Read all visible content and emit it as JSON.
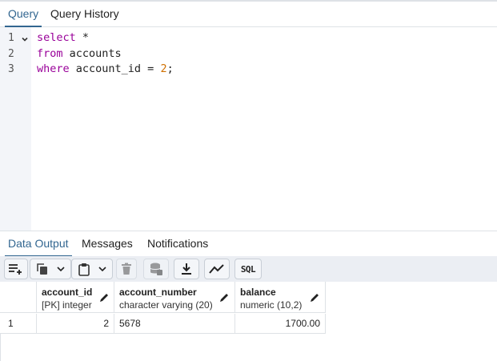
{
  "editor_tabs": [
    {
      "label": "Query",
      "active": true
    },
    {
      "label": "Query History",
      "active": false
    }
  ],
  "editor": {
    "lines": [
      {
        "number": "1",
        "tokens": [
          {
            "t": "select",
            "k": "kw"
          },
          {
            "t": " *",
            "k": "plain"
          }
        ]
      },
      {
        "number": "2",
        "tokens": [
          {
            "t": "from",
            "k": "kw"
          },
          {
            "t": " accounts",
            "k": "plain"
          }
        ]
      },
      {
        "number": "3",
        "tokens": [
          {
            "t": "where",
            "k": "kw"
          },
          {
            "t": " account_id = ",
            "k": "plain"
          },
          {
            "t": "2",
            "k": "num"
          },
          {
            "t": ";",
            "k": "plain"
          }
        ]
      }
    ]
  },
  "output_tabs": [
    {
      "label": "Data Output",
      "active": true
    },
    {
      "label": "Messages",
      "active": false
    },
    {
      "label": "Notifications",
      "active": false
    }
  ],
  "toolbar": {
    "buttons": [
      {
        "name": "add-row-button",
        "icon": "add-row-icon"
      },
      {
        "name": "copy-button",
        "icon": "copy-icon"
      },
      {
        "name": "copy-options-dropdown",
        "icon": "chevron-down-icon"
      },
      {
        "name": "paste-button",
        "icon": "paste-icon"
      },
      {
        "name": "paste-options-dropdown",
        "icon": "chevron-down-icon"
      },
      {
        "name": "delete-button",
        "icon": "trash-icon",
        "disabled": true
      },
      {
        "name": "save-data-button",
        "icon": "database-save-icon",
        "disabled": true
      },
      {
        "name": "download-button",
        "icon": "download-icon"
      },
      {
        "name": "graph-visualiser-button",
        "icon": "line-chart-icon"
      },
      {
        "name": "sql-button",
        "icon": "sql-icon",
        "label": "SQL"
      }
    ]
  },
  "result_grid": {
    "columns": [
      {
        "name": "account_id",
        "type": "[PK] integer"
      },
      {
        "name": "account_number",
        "type": "character varying (20)"
      },
      {
        "name": "balance",
        "type": "numeric (10,2)"
      }
    ],
    "rows": [
      {
        "row_number": "1",
        "values": [
          "2",
          "5678",
          "1700.00"
        ]
      }
    ]
  },
  "colors": {
    "accent": "#326690",
    "keyword": "#990099",
    "number": "#d07000"
  }
}
